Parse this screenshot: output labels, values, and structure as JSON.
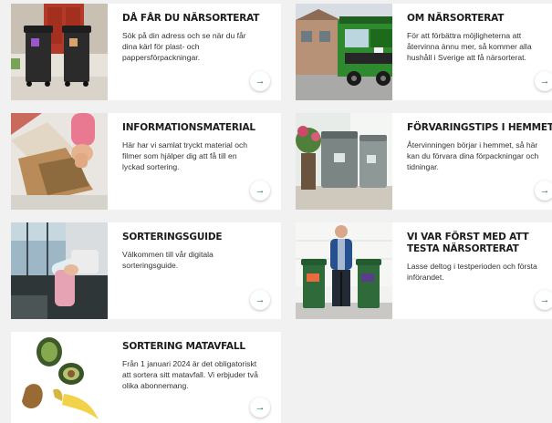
{
  "cards": [
    {
      "title": "DÅ FÅR DU NÄRSORTERAT",
      "text": "Sök på din adress och se när du får dina kärl för plast- och pappersförpackningar."
    },
    {
      "title": "OM NÄRSORTERAT",
      "text": "För att förbättra möjligheterna att återvinna ännu mer, så kommer alla hushåll i Sverige att få närsorterat."
    },
    {
      "title": "INFORMATIONSMATERIAL",
      "text": "Här har vi samlat tryckt material och filmer som hjälper dig att få till en lyckad sortering."
    },
    {
      "title": "FÖRVARINGSTIPS I HEMMET",
      "text": "Återvinningen börjar i hemmet, så här kan du förvara dina förpackningar och tidningar."
    },
    {
      "title": "SORTERINGSGUIDE",
      "text": "Välkommen till vår digitala sorteringsguide."
    },
    {
      "title": "VI VAR FÖRST MED ATT TESTA NÄRSORTERAT",
      "text": "Lasse deltog i testperioden och första införandet."
    },
    {
      "title": "SORTERING MATAVFALL",
      "text": "Från 1 januari 2024 är det obligatoriskt att sortera sitt matavfall. Vi erbjuder två olika abonnemang."
    }
  ],
  "arrow_glyph": "→",
  "colors": {
    "accent": "#1d6b3a",
    "background": "#f1f1f1",
    "card": "#ffffff"
  }
}
